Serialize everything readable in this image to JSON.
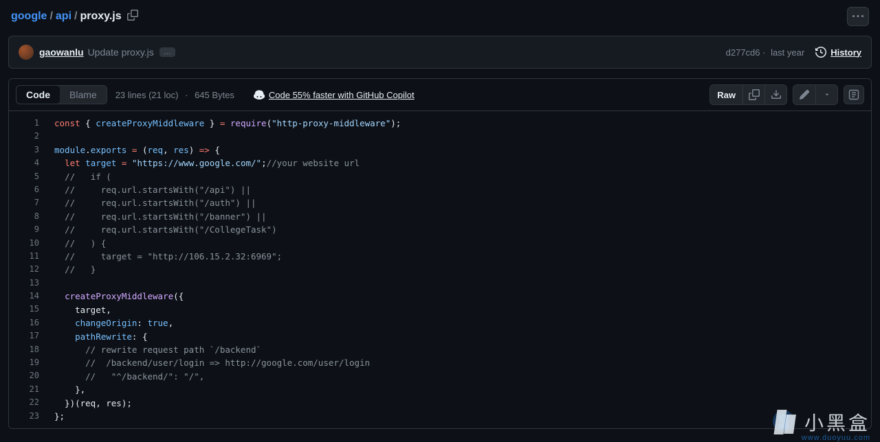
{
  "breadcrumb": {
    "parts": [
      "google",
      "api"
    ],
    "current": "proxy.js"
  },
  "commit": {
    "author": "gaowanlu",
    "message": "Update proxy.js",
    "badge": "…",
    "sha": "d277cd6",
    "date": "last year",
    "history_label": "History"
  },
  "toolbar": {
    "code_tab": "Code",
    "blame_tab": "Blame",
    "lines": "23 lines (21 loc)",
    "bytes": "645 Bytes",
    "copilot": "Code 55% faster with GitHub Copilot",
    "raw": "Raw"
  },
  "code": {
    "line_count": 23,
    "str_require": "\"http-proxy-middleware\"",
    "str_target": "\"https://www.google.com/\"",
    "com_url": "//your website url",
    "com_5": "//   if (",
    "com_6": "//     req.url.startsWith(\"/api\") ||",
    "com_7": "//     req.url.startsWith(\"/auth\") ||",
    "com_8": "//     req.url.startsWith(\"/banner\") ||",
    "com_9": "//     req.url.startsWith(\"/CollegeTask\")",
    "com_10": "//   ) {",
    "com_11": "//     target = \"http://106.15.2.32:6969\";",
    "com_12": "//   }",
    "com_18": "// rewrite request path `/backend`",
    "com_19": "//  /backend/user/login => http://google.com/user/login",
    "com_20": "//   \"^/backend/\": \"/\","
  },
  "watermark": {
    "text": "小黑盒",
    "url": "www.duoyuu.com"
  }
}
